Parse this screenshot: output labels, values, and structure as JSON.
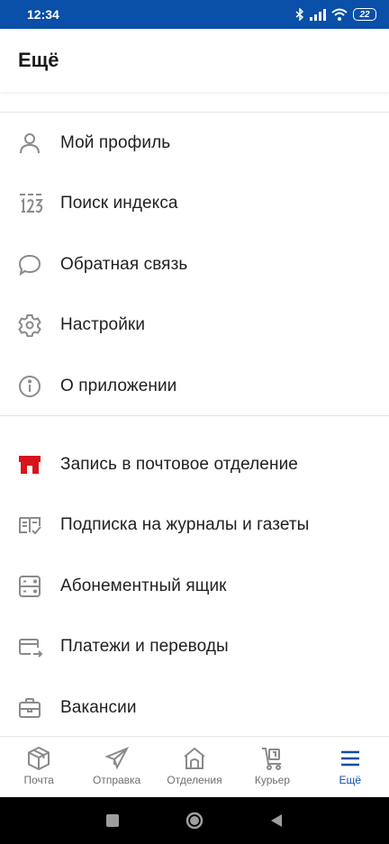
{
  "status_bar": {
    "time": "12:34",
    "battery": "22",
    "bg_color": "#0a4fa8"
  },
  "header": {
    "title": "Ещё"
  },
  "menu_group_1": [
    {
      "icon": "person-icon",
      "label": "Мой профиль"
    },
    {
      "icon": "index-123-icon",
      "label": "Поиск индекса"
    },
    {
      "icon": "chat-bubble-icon",
      "label": "Обратная связь"
    },
    {
      "icon": "gear-icon",
      "label": "Настройки"
    },
    {
      "icon": "info-icon",
      "label": "О приложении"
    }
  ],
  "menu_group_2": [
    {
      "icon": "post-office-icon",
      "label": "Запись в почтовое отделение",
      "icon_color": "#d7141a"
    },
    {
      "icon": "newspaper-icon",
      "label": "Подписка на журналы и газеты"
    },
    {
      "icon": "mailbox-icon",
      "label": "Абонементный ящик"
    },
    {
      "icon": "card-transfer-icon",
      "label": "Платежи и переводы"
    },
    {
      "icon": "briefcase-icon",
      "label": "Вакансии"
    }
  ],
  "bottom_nav": [
    {
      "icon": "box-icon",
      "label": "Почта",
      "active": false
    },
    {
      "icon": "paper-plane-icon",
      "label": "Отправка",
      "active": false
    },
    {
      "icon": "house-icon",
      "label": "Отделения",
      "active": false
    },
    {
      "icon": "courier-cart-icon",
      "label": "Курьер",
      "active": false
    },
    {
      "icon": "hamburger-icon",
      "label": "Ещё",
      "active": true
    }
  ],
  "colors": {
    "accent": "#0a4fa8",
    "icon_gray": "#8a8a8a",
    "red": "#d7141a"
  }
}
